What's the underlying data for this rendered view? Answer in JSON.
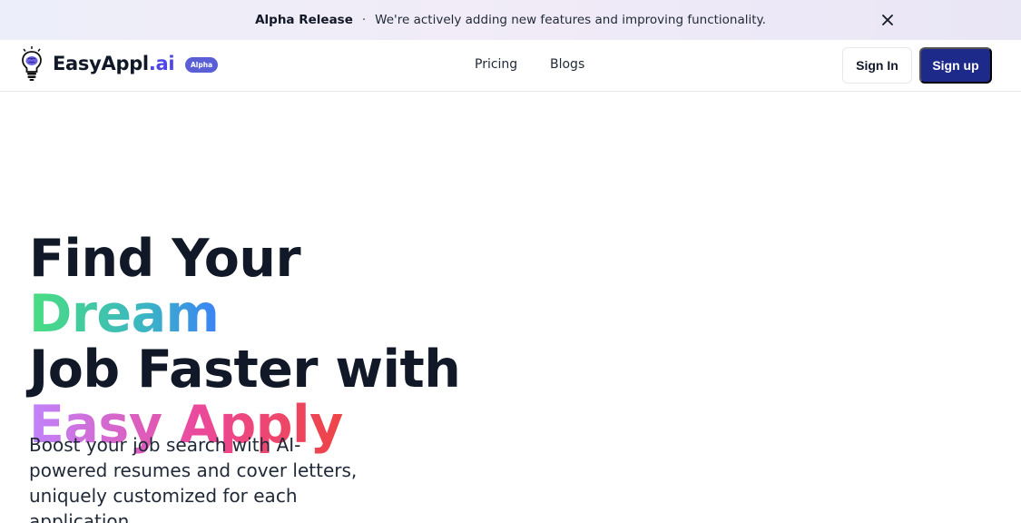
{
  "banner": {
    "title": "Alpha Release",
    "separator": "·",
    "message": "We're actively adding new features and improving functionality."
  },
  "nav": {
    "brand_main": "EasyAppl",
    "brand_suffix": ".ai",
    "badge": "Alpha",
    "links": [
      "Pricing",
      "Blogs"
    ],
    "signin_label": "Sign In",
    "signup_label": "Sign up"
  },
  "hero": {
    "title_part1": "Find Your ",
    "title_highlight1": "Dream",
    "title_part2": "Job Faster with",
    "title_highlight2": "Easy Apply",
    "subtitle": "Boost your job search with AI-powered resumes and cover letters, uniquely customized for each application."
  },
  "colors": {
    "primary_button": "#1e2a8a",
    "brand_accent": "#4f46e5",
    "badge": "#5b5fd6",
    "gradient_green_start": "#4ade80",
    "gradient_green_end": "#3b82f6",
    "gradient_pink_start": "#c084fc",
    "gradient_pink_end": "#ef4444"
  },
  "icons": {
    "logo": "lightbulb-brain-icon",
    "close": "close-icon"
  }
}
